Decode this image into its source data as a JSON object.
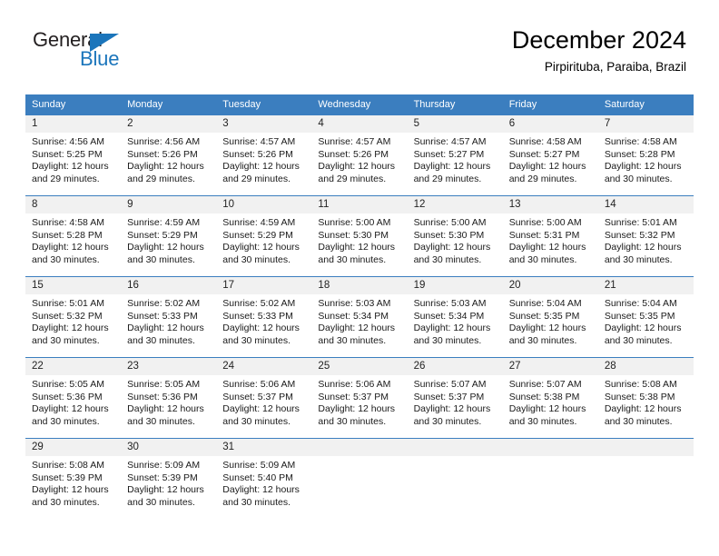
{
  "branding": {
    "logo_text_primary": "General",
    "logo_text_secondary": "Blue",
    "logo_primary_color": "#231f20",
    "logo_accent_color": "#1b75bb"
  },
  "header": {
    "month_title": "December 2024",
    "location": "Pirpirituba, Paraiba, Brazil"
  },
  "theme": {
    "header_row_background": "#3b7ebf",
    "header_row_text": "#ffffff",
    "daynumber_strip_background": "#f1f1f1",
    "week_separator_color": "#3b7ebf",
    "page_background": "#ffffff",
    "body_text": "#1a1a1a"
  },
  "weekday_headers": [
    "Sunday",
    "Monday",
    "Tuesday",
    "Wednesday",
    "Thursday",
    "Friday",
    "Saturday"
  ],
  "labels": {
    "sunrise_prefix": "Sunrise:",
    "sunset_prefix": "Sunset:",
    "daylight_prefix": "Daylight:"
  },
  "weeks": [
    [
      {
        "day": "1",
        "sunrise": "Sunrise: 4:56 AM",
        "sunset": "Sunset: 5:25 PM",
        "daylight": "Daylight: 12 hours and 29 minutes."
      },
      {
        "day": "2",
        "sunrise": "Sunrise: 4:56 AM",
        "sunset": "Sunset: 5:26 PM",
        "daylight": "Daylight: 12 hours and 29 minutes."
      },
      {
        "day": "3",
        "sunrise": "Sunrise: 4:57 AM",
        "sunset": "Sunset: 5:26 PM",
        "daylight": "Daylight: 12 hours and 29 minutes."
      },
      {
        "day": "4",
        "sunrise": "Sunrise: 4:57 AM",
        "sunset": "Sunset: 5:26 PM",
        "daylight": "Daylight: 12 hours and 29 minutes."
      },
      {
        "day": "5",
        "sunrise": "Sunrise: 4:57 AM",
        "sunset": "Sunset: 5:27 PM",
        "daylight": "Daylight: 12 hours and 29 minutes."
      },
      {
        "day": "6",
        "sunrise": "Sunrise: 4:58 AM",
        "sunset": "Sunset: 5:27 PM",
        "daylight": "Daylight: 12 hours and 29 minutes."
      },
      {
        "day": "7",
        "sunrise": "Sunrise: 4:58 AM",
        "sunset": "Sunset: 5:28 PM",
        "daylight": "Daylight: 12 hours and 30 minutes."
      }
    ],
    [
      {
        "day": "8",
        "sunrise": "Sunrise: 4:58 AM",
        "sunset": "Sunset: 5:28 PM",
        "daylight": "Daylight: 12 hours and 30 minutes."
      },
      {
        "day": "9",
        "sunrise": "Sunrise: 4:59 AM",
        "sunset": "Sunset: 5:29 PM",
        "daylight": "Daylight: 12 hours and 30 minutes."
      },
      {
        "day": "10",
        "sunrise": "Sunrise: 4:59 AM",
        "sunset": "Sunset: 5:29 PM",
        "daylight": "Daylight: 12 hours and 30 minutes."
      },
      {
        "day": "11",
        "sunrise": "Sunrise: 5:00 AM",
        "sunset": "Sunset: 5:30 PM",
        "daylight": "Daylight: 12 hours and 30 minutes."
      },
      {
        "day": "12",
        "sunrise": "Sunrise: 5:00 AM",
        "sunset": "Sunset: 5:30 PM",
        "daylight": "Daylight: 12 hours and 30 minutes."
      },
      {
        "day": "13",
        "sunrise": "Sunrise: 5:00 AM",
        "sunset": "Sunset: 5:31 PM",
        "daylight": "Daylight: 12 hours and 30 minutes."
      },
      {
        "day": "14",
        "sunrise": "Sunrise: 5:01 AM",
        "sunset": "Sunset: 5:32 PM",
        "daylight": "Daylight: 12 hours and 30 minutes."
      }
    ],
    [
      {
        "day": "15",
        "sunrise": "Sunrise: 5:01 AM",
        "sunset": "Sunset: 5:32 PM",
        "daylight": "Daylight: 12 hours and 30 minutes."
      },
      {
        "day": "16",
        "sunrise": "Sunrise: 5:02 AM",
        "sunset": "Sunset: 5:33 PM",
        "daylight": "Daylight: 12 hours and 30 minutes."
      },
      {
        "day": "17",
        "sunrise": "Sunrise: 5:02 AM",
        "sunset": "Sunset: 5:33 PM",
        "daylight": "Daylight: 12 hours and 30 minutes."
      },
      {
        "day": "18",
        "sunrise": "Sunrise: 5:03 AM",
        "sunset": "Sunset: 5:34 PM",
        "daylight": "Daylight: 12 hours and 30 minutes."
      },
      {
        "day": "19",
        "sunrise": "Sunrise: 5:03 AM",
        "sunset": "Sunset: 5:34 PM",
        "daylight": "Daylight: 12 hours and 30 minutes."
      },
      {
        "day": "20",
        "sunrise": "Sunrise: 5:04 AM",
        "sunset": "Sunset: 5:35 PM",
        "daylight": "Daylight: 12 hours and 30 minutes."
      },
      {
        "day": "21",
        "sunrise": "Sunrise: 5:04 AM",
        "sunset": "Sunset: 5:35 PM",
        "daylight": "Daylight: 12 hours and 30 minutes."
      }
    ],
    [
      {
        "day": "22",
        "sunrise": "Sunrise: 5:05 AM",
        "sunset": "Sunset: 5:36 PM",
        "daylight": "Daylight: 12 hours and 30 minutes."
      },
      {
        "day": "23",
        "sunrise": "Sunrise: 5:05 AM",
        "sunset": "Sunset: 5:36 PM",
        "daylight": "Daylight: 12 hours and 30 minutes."
      },
      {
        "day": "24",
        "sunrise": "Sunrise: 5:06 AM",
        "sunset": "Sunset: 5:37 PM",
        "daylight": "Daylight: 12 hours and 30 minutes."
      },
      {
        "day": "25",
        "sunrise": "Sunrise: 5:06 AM",
        "sunset": "Sunset: 5:37 PM",
        "daylight": "Daylight: 12 hours and 30 minutes."
      },
      {
        "day": "26",
        "sunrise": "Sunrise: 5:07 AM",
        "sunset": "Sunset: 5:37 PM",
        "daylight": "Daylight: 12 hours and 30 minutes."
      },
      {
        "day": "27",
        "sunrise": "Sunrise: 5:07 AM",
        "sunset": "Sunset: 5:38 PM",
        "daylight": "Daylight: 12 hours and 30 minutes."
      },
      {
        "day": "28",
        "sunrise": "Sunrise: 5:08 AM",
        "sunset": "Sunset: 5:38 PM",
        "daylight": "Daylight: 12 hours and 30 minutes."
      }
    ],
    [
      {
        "day": "29",
        "sunrise": "Sunrise: 5:08 AM",
        "sunset": "Sunset: 5:39 PM",
        "daylight": "Daylight: 12 hours and 30 minutes."
      },
      {
        "day": "30",
        "sunrise": "Sunrise: 5:09 AM",
        "sunset": "Sunset: 5:39 PM",
        "daylight": "Daylight: 12 hours and 30 minutes."
      },
      {
        "day": "31",
        "sunrise": "Sunrise: 5:09 AM",
        "sunset": "Sunset: 5:40 PM",
        "daylight": "Daylight: 12 hours and 30 minutes."
      },
      {
        "day": "",
        "sunrise": "",
        "sunset": "",
        "daylight": ""
      },
      {
        "day": "",
        "sunrise": "",
        "sunset": "",
        "daylight": ""
      },
      {
        "day": "",
        "sunrise": "",
        "sunset": "",
        "daylight": ""
      },
      {
        "day": "",
        "sunrise": "",
        "sunset": "",
        "daylight": ""
      }
    ]
  ]
}
